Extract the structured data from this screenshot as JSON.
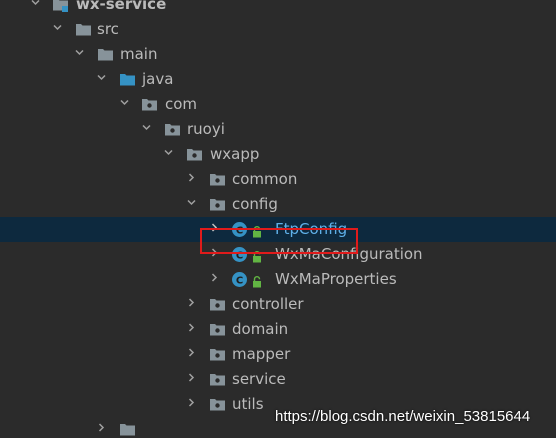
{
  "tree": {
    "root": {
      "label": "wx-service",
      "expanded": true,
      "icon": "module-folder-icon"
    },
    "items": [
      {
        "label": "src",
        "icon": "folder-icon",
        "expanded": true
      },
      {
        "label": "main",
        "icon": "folder-icon",
        "expanded": true
      },
      {
        "label": "java",
        "icon": "source-root-folder-icon",
        "expanded": true
      },
      {
        "label": "com",
        "icon": "package-icon",
        "expanded": true
      },
      {
        "label": "ruoyi",
        "icon": "package-icon",
        "expanded": true
      },
      {
        "label": "wxapp",
        "icon": "package-icon",
        "expanded": true
      },
      {
        "label": "common",
        "icon": "package-icon",
        "expanded": false
      },
      {
        "label": "config",
        "icon": "package-icon",
        "expanded": true
      },
      {
        "label": "FtpConfig",
        "icon": "class-icon",
        "expanded": false,
        "selected": true
      },
      {
        "label": "WxMaConfiguration",
        "icon": "class-icon",
        "expanded": false
      },
      {
        "label": "WxMaProperties",
        "icon": "class-icon",
        "expanded": false
      },
      {
        "label": "controller",
        "icon": "package-icon",
        "expanded": false
      },
      {
        "label": "domain",
        "icon": "package-icon",
        "expanded": false
      },
      {
        "label": "mapper",
        "icon": "package-icon",
        "expanded": false
      },
      {
        "label": "service",
        "icon": "package-icon",
        "expanded": false
      },
      {
        "label": "utils",
        "icon": "package-icon",
        "expanded": false
      }
    ]
  },
  "colors": {
    "background": "#2b2b2b",
    "selection": "#0d293e",
    "folder": "#87939a",
    "source_root": "#3592c4",
    "class_badge": "#3592c4",
    "lock": "#62b543",
    "highlight_box": "#e01b1b"
  },
  "watermark": {
    "text": "https://blog.csdn.net/weixin_53815644"
  }
}
